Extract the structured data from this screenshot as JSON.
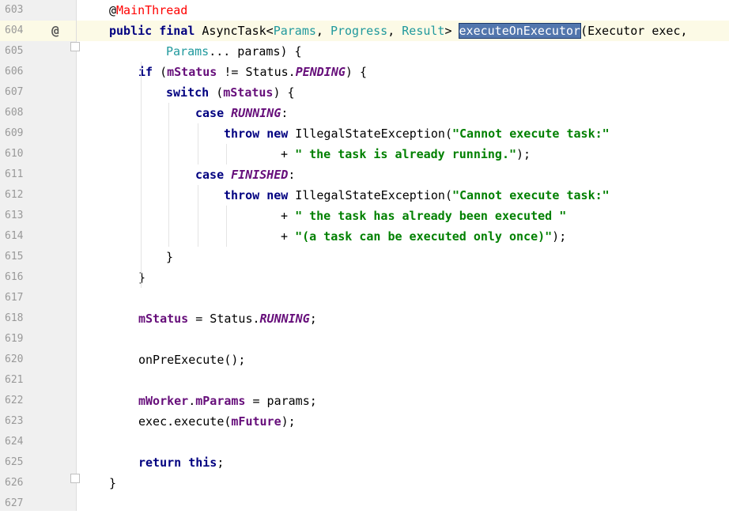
{
  "editor": {
    "gutter": {
      "line_numbers": [
        "603",
        "604",
        "605",
        "606",
        "607",
        "608",
        "609",
        "610",
        "611",
        "612",
        "613",
        "614",
        "615",
        "616",
        "617",
        "618",
        "619",
        "620",
        "621",
        "622",
        "623",
        "624",
        "625",
        "626",
        "627"
      ],
      "override_marker_icon": "override-at-icon"
    },
    "lines": [
      {
        "segments": [
          {
            "cls": "plain",
            "text": "@"
          },
          {
            "cls": "anno-name",
            "text": "MainThread"
          }
        ]
      },
      {
        "segments": [
          {
            "cls": "kw",
            "text": "public"
          },
          {
            "cls": "plain",
            "text": " "
          },
          {
            "cls": "kw",
            "text": "final"
          },
          {
            "cls": "plain",
            "text": " AsyncTask<"
          },
          {
            "cls": "type-param",
            "text": "Params"
          },
          {
            "cls": "plain",
            "text": ", "
          },
          {
            "cls": "type-param",
            "text": "Progress"
          },
          {
            "cls": "plain",
            "text": ", "
          },
          {
            "cls": "type-param",
            "text": "Result"
          },
          {
            "cls": "plain",
            "text": "> "
          },
          {
            "cls": "sel",
            "text": "executeOnExecutor"
          },
          {
            "cls": "plain",
            "text": "(Executor exec,"
          }
        ]
      },
      {
        "segments": [
          {
            "cls": "type-param",
            "text": "Params"
          },
          {
            "cls": "plain",
            "text": "... params) {"
          }
        ]
      },
      {
        "segments": [
          {
            "cls": "kw",
            "text": "if"
          },
          {
            "cls": "plain",
            "text": " ("
          },
          {
            "cls": "field",
            "text": "mStatus"
          },
          {
            "cls": "plain",
            "text": " != Status."
          },
          {
            "cls": "const",
            "text": "PENDING"
          },
          {
            "cls": "plain",
            "text": ") {"
          }
        ]
      },
      {
        "segments": [
          {
            "cls": "kw",
            "text": "switch"
          },
          {
            "cls": "plain",
            "text": " ("
          },
          {
            "cls": "field",
            "text": "mStatus"
          },
          {
            "cls": "plain",
            "text": ") {"
          }
        ]
      },
      {
        "segments": [
          {
            "cls": "kw",
            "text": "case"
          },
          {
            "cls": "plain",
            "text": " "
          },
          {
            "cls": "const",
            "text": "RUNNING"
          },
          {
            "cls": "plain",
            "text": ":"
          }
        ]
      },
      {
        "segments": [
          {
            "cls": "kw",
            "text": "throw"
          },
          {
            "cls": "plain",
            "text": " "
          },
          {
            "cls": "kw",
            "text": "new"
          },
          {
            "cls": "plain",
            "text": " IllegalStateException("
          },
          {
            "cls": "str",
            "text": "\"Cannot execute task:\""
          }
        ]
      },
      {
        "segments": [
          {
            "cls": "plain",
            "text": "+ "
          },
          {
            "cls": "str",
            "text": "\" the task is already running.\""
          },
          {
            "cls": "plain",
            "text": ");"
          }
        ]
      },
      {
        "segments": [
          {
            "cls": "kw",
            "text": "case"
          },
          {
            "cls": "plain",
            "text": " "
          },
          {
            "cls": "const",
            "text": "FINISHED"
          },
          {
            "cls": "plain",
            "text": ":"
          }
        ]
      },
      {
        "segments": [
          {
            "cls": "kw",
            "text": "throw"
          },
          {
            "cls": "plain",
            "text": " "
          },
          {
            "cls": "kw",
            "text": "new"
          },
          {
            "cls": "plain",
            "text": " IllegalStateException("
          },
          {
            "cls": "str",
            "text": "\"Cannot execute task:\""
          }
        ]
      },
      {
        "segments": [
          {
            "cls": "plain",
            "text": "+ "
          },
          {
            "cls": "str",
            "text": "\" the task has already been executed \""
          }
        ]
      },
      {
        "segments": [
          {
            "cls": "plain",
            "text": "+ "
          },
          {
            "cls": "str",
            "text": "\"(a task can be executed only once)\""
          },
          {
            "cls": "plain",
            "text": ");"
          }
        ]
      },
      {
        "segments": [
          {
            "cls": "plain",
            "text": "}"
          }
        ]
      },
      {
        "segments": [
          {
            "cls": "plain",
            "text": "}"
          }
        ]
      },
      {
        "segments": []
      },
      {
        "segments": [
          {
            "cls": "field",
            "text": "mStatus"
          },
          {
            "cls": "plain",
            "text": " = Status."
          },
          {
            "cls": "const",
            "text": "RUNNING"
          },
          {
            "cls": "plain",
            "text": ";"
          }
        ]
      },
      {
        "segments": []
      },
      {
        "segments": [
          {
            "cls": "plain",
            "text": "onPreExecute();"
          }
        ]
      },
      {
        "segments": []
      },
      {
        "segments": [
          {
            "cls": "field",
            "text": "mWorker"
          },
          {
            "cls": "plain",
            "text": "."
          },
          {
            "cls": "field",
            "text": "mParams"
          },
          {
            "cls": "plain",
            "text": " = params;"
          }
        ]
      },
      {
        "segments": [
          {
            "cls": "plain",
            "text": "exec.execute("
          },
          {
            "cls": "field",
            "text": "mFuture"
          },
          {
            "cls": "plain",
            "text": ");"
          }
        ]
      },
      {
        "segments": []
      },
      {
        "segments": [
          {
            "cls": "kw",
            "text": "return"
          },
          {
            "cls": "plain",
            "text": " "
          },
          {
            "cls": "kw",
            "text": "this"
          },
          {
            "cls": "plain",
            "text": ";"
          }
        ]
      },
      {
        "segments": [
          {
            "cls": "plain",
            "text": "}"
          }
        ]
      },
      {
        "segments": []
      }
    ],
    "selected_text": "executeOnExecutor",
    "colors": {
      "keyword": "#000080",
      "type_param": "#20999d",
      "field": "#660e7a",
      "string": "#008000",
      "annotation_name": "#ff0000",
      "selection": "#5276ad",
      "current_line": "#fcfae6",
      "gutter_bg": "#f0f0f0"
    }
  }
}
